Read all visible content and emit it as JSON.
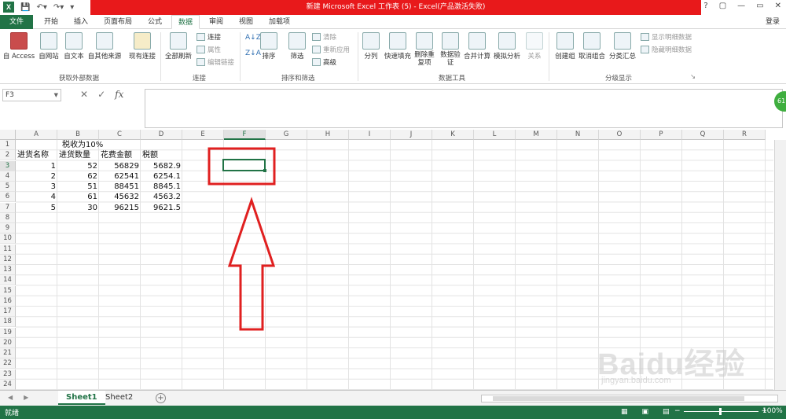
{
  "window": {
    "title": "新建 Microsoft Excel 工作表 (5) -  Excel(产品激活失败)",
    "controls": [
      "?",
      "▢",
      "—",
      "▭",
      "✕"
    ]
  },
  "tabs": {
    "file": "文件",
    "items": [
      "开始",
      "插入",
      "页面布局",
      "公式",
      "数据",
      "审阅",
      "视图",
      "加载项"
    ],
    "active": "数据",
    "login": "登录"
  },
  "ribbon": {
    "get_external": {
      "access": "自 Access",
      "web": "自网站",
      "text": "自文本",
      "other": "自其他来源",
      "existing": "现有连接",
      "label": "获取外部数据"
    },
    "connections": {
      "refresh_all": "全部刷新",
      "conn": "连接",
      "props": "属性",
      "edit_links": "编辑链接",
      "label": "连接"
    },
    "sort_filter": {
      "sort": "排序",
      "filter": "筛选",
      "clear": "清除",
      "reapply": "重新应用",
      "advanced": "高级",
      "label": "排序和筛选"
    },
    "data_tools": {
      "text_to_cols": "分列",
      "flash_fill": "快速填充",
      "remove_dup": "删除重复项",
      "validation": "数据验证",
      "consolidate": "合并计算",
      "what_if": "模拟分析",
      "relations": "关系",
      "label": "数据工具"
    },
    "outline": {
      "group": "创建组",
      "ungroup": "取消组合",
      "subtotal": "分类汇总",
      "show_detail": "显示明细数据",
      "hide_detail": "隐藏明细数据",
      "label": "分级显示"
    }
  },
  "formula_bar": {
    "name_box": "F3",
    "formula": "",
    "fx": "fx"
  },
  "badge": "61",
  "columns": [
    "A",
    "B",
    "C",
    "D",
    "E",
    "F",
    "G",
    "H",
    "I",
    "J",
    "K",
    "L",
    "M",
    "N",
    "O",
    "P",
    "Q",
    "R"
  ],
  "selected_column": "F",
  "rows": [
    "1",
    "2",
    "3",
    "4",
    "5",
    "6",
    "7",
    "8",
    "9",
    "10",
    "11",
    "12",
    "13",
    "14",
    "15",
    "16",
    "17",
    "18",
    "19",
    "20",
    "21",
    "22",
    "23",
    "24"
  ],
  "selected_row": "3",
  "sheet": {
    "title_cell": "税收为10%",
    "headers": [
      "进货名称",
      "进货数量",
      "花费金额",
      "税额"
    ],
    "data": [
      [
        "1",
        "52",
        "56829",
        "5682.9"
      ],
      [
        "2",
        "62",
        "62541",
        "6254.1"
      ],
      [
        "3",
        "51",
        "88451",
        "8845.1"
      ],
      [
        "4",
        "61",
        "45632",
        "4563.2"
      ],
      [
        "5",
        "30",
        "96215",
        "9621.5"
      ]
    ]
  },
  "sheet_tabs": {
    "tabs": [
      "Sheet1",
      "Sheet2"
    ],
    "active": "Sheet1",
    "add": "+"
  },
  "status": {
    "ready": "就绪",
    "zoom": "100%"
  },
  "watermark": {
    "brand": "Baidu经验",
    "url": "jingyan.baidu.com"
  },
  "annotation_color": "#e02020",
  "accent_color": "#217346"
}
